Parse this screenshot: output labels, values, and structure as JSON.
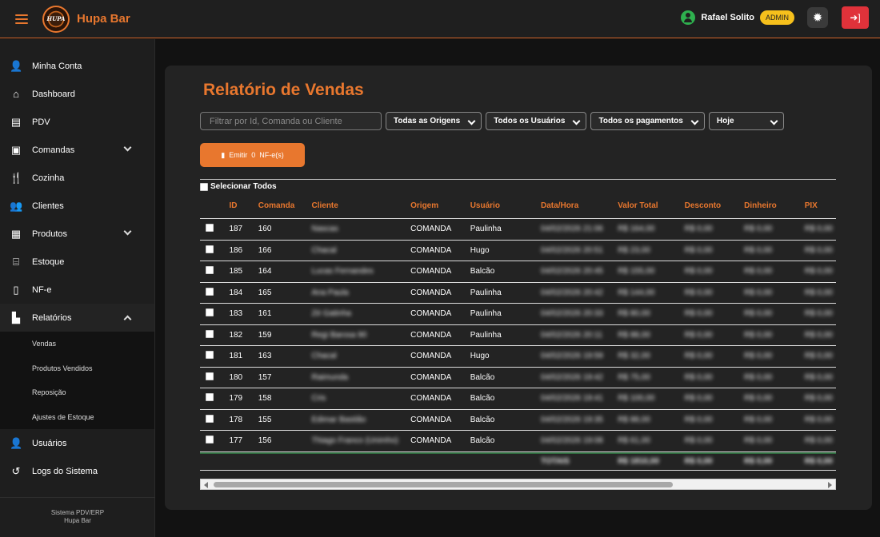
{
  "app": {
    "brand": "Hupa Bar",
    "logo_text": "HUPA",
    "user_name": "Rafael Solito",
    "role_badge": "ADMIN"
  },
  "sidebar": {
    "items": [
      {
        "label": "Minha Conta",
        "icon": "user-icon"
      },
      {
        "label": "Dashboard",
        "icon": "home-icon"
      },
      {
        "label": "PDV",
        "icon": "cash-register-icon"
      },
      {
        "label": "Comandas",
        "icon": "clipboard-icon"
      },
      {
        "label": "Cozinha",
        "icon": "utensils-icon"
      },
      {
        "label": "Clientes",
        "icon": "users-icon"
      },
      {
        "label": "Produtos",
        "icon": "box-icon"
      },
      {
        "label": "Estoque",
        "icon": "warehouse-icon"
      },
      {
        "label": "NF-e",
        "icon": "file-icon"
      },
      {
        "label": "Relatórios",
        "icon": "chart-icon"
      }
    ],
    "sub_items": [
      "Vendas",
      "Produtos Vendidos",
      "Reposição",
      "Ajustes de Estoque"
    ],
    "bottom_items": [
      {
        "label": "Usuários",
        "icon": "user-gear-icon"
      },
      {
        "label": "Logs do Sistema",
        "icon": "history-icon"
      }
    ],
    "footer_line1": "Sistema PDV/ERP",
    "footer_line2": "Hupa Bar"
  },
  "page": {
    "title": "Relatório de Vendas",
    "search_placeholder": "Filtrar por Id, Comanda ou Cliente",
    "filter_origin": "Todas as Origens",
    "filter_users": "Todos os Usuários",
    "filter_payments": "Todos os pagamentos",
    "filter_period": "Hoje",
    "emit_label": "Emitir",
    "emit_count": "0",
    "emit_suffix": "NF-e(s)",
    "select_all": "Selecionar Todos"
  },
  "table": {
    "headers": [
      "ID",
      "Comanda",
      "Cliente",
      "Origem",
      "Usuário",
      "Data/Hora",
      "Valor Total",
      "Desconto",
      "Dinheiro",
      "PIX"
    ],
    "rows": [
      {
        "id": "187",
        "comanda": "160",
        "cliente": "Nascas",
        "origem": "COMANDA",
        "usuario": "Paulinha",
        "data": "04/02/2026 21:06",
        "total": "R$ 164,00",
        "desconto": "R$ 0,00",
        "dinheiro": "R$ 0,00",
        "pix": "R$ 0,00"
      },
      {
        "id": "186",
        "comanda": "166",
        "cliente": "Chacal",
        "origem": "COMANDA",
        "usuario": "Hugo",
        "data": "04/02/2026 20:51",
        "total": "R$ 23,00",
        "desconto": "R$ 0,00",
        "dinheiro": "R$ 0,00",
        "pix": "R$ 0,00"
      },
      {
        "id": "185",
        "comanda": "164",
        "cliente": "Lucas Fernandes",
        "origem": "COMANDA",
        "usuario": "Balcão",
        "data": "04/02/2026 20:45",
        "total": "R$ 155,00",
        "desconto": "R$ 0,00",
        "dinheiro": "R$ 0,00",
        "pix": "R$ 0,00"
      },
      {
        "id": "184",
        "comanda": "165",
        "cliente": "Ana Paula",
        "origem": "COMANDA",
        "usuario": "Paulinha",
        "data": "04/02/2026 20:42",
        "total": "R$ 144,00",
        "desconto": "R$ 0,00",
        "dinheiro": "R$ 0,00",
        "pix": "R$ 0,00"
      },
      {
        "id": "183",
        "comanda": "161",
        "cliente": "Zé Gatinha",
        "origem": "COMANDA",
        "usuario": "Paulinha",
        "data": "04/02/2026 20:33",
        "total": "R$ 80,00",
        "desconto": "R$ 0,00",
        "dinheiro": "R$ 0,00",
        "pix": "R$ 0,00"
      },
      {
        "id": "182",
        "comanda": "159",
        "cliente": "Regi Barosa 90",
        "origem": "COMANDA",
        "usuario": "Paulinha",
        "data": "04/02/2026 20:11",
        "total": "R$ 88,00",
        "desconto": "R$ 0,00",
        "dinheiro": "R$ 0,00",
        "pix": "R$ 0,00"
      },
      {
        "id": "181",
        "comanda": "163",
        "cliente": "Chacal",
        "origem": "COMANDA",
        "usuario": "Hugo",
        "data": "04/02/2026 19:59",
        "total": "R$ 32,00",
        "desconto": "R$ 0,00",
        "dinheiro": "R$ 0,00",
        "pix": "R$ 0,00"
      },
      {
        "id": "180",
        "comanda": "157",
        "cliente": "Raimunda",
        "origem": "COMANDA",
        "usuario": "Balcão",
        "data": "04/02/2026 19:42",
        "total": "R$ 75,00",
        "desconto": "R$ 0,00",
        "dinheiro": "R$ 0,00",
        "pix": "R$ 0,00"
      },
      {
        "id": "179",
        "comanda": "158",
        "cliente": "Cris",
        "origem": "COMANDA",
        "usuario": "Balcão",
        "data": "04/02/2026 19:41",
        "total": "R$ 100,00",
        "desconto": "R$ 0,00",
        "dinheiro": "R$ 0,00",
        "pix": "R$ 0,00"
      },
      {
        "id": "178",
        "comanda": "155",
        "cliente": "Edimar Bastião",
        "origem": "COMANDA",
        "usuario": "Balcão",
        "data": "04/02/2026 19:35",
        "total": "R$ 88,00",
        "desconto": "R$ 0,00",
        "dinheiro": "R$ 0,00",
        "pix": "R$ 0,00"
      },
      {
        "id": "177",
        "comanda": "156",
        "cliente": "Thiago Franco (Unimho)",
        "origem": "COMANDA",
        "usuario": "Balcão",
        "data": "04/02/2026 19:08",
        "total": "R$ 61,00",
        "desconto": "R$ 0,00",
        "dinheiro": "R$ 0,00",
        "pix": "R$ 0,00"
      }
    ],
    "totals": {
      "label": "TOTAIS",
      "total": "R$ 1810,00",
      "desconto": "R$ 0,00",
      "dinheiro": "R$ 0,00",
      "pix": "R$ 0,00"
    }
  },
  "colors": {
    "accent": "#e8772e",
    "badge": "#f6c01c",
    "logout": "#e0323a",
    "online": "#2eb04e"
  }
}
